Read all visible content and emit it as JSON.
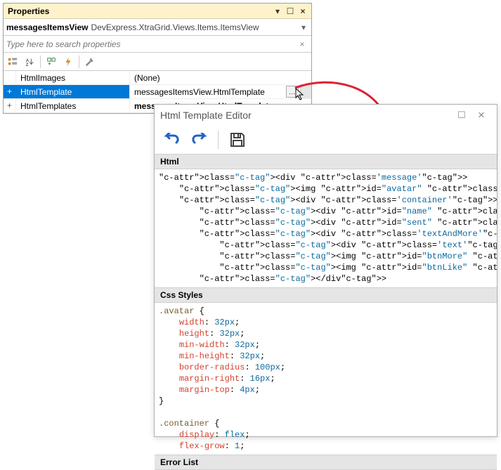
{
  "properties": {
    "title": "Properties",
    "object_name": "messagesItemsView",
    "object_type": "DevExpress.XtraGrid.Views.Items.ItemsView",
    "search_placeholder": "Type here to search properties",
    "rows": [
      {
        "exp": "",
        "name": "HtmlImages",
        "value": "(None)",
        "bold": false,
        "sel": false,
        "btn": false
      },
      {
        "exp": "+",
        "name": "HtmlTemplate",
        "value": "messagesItemsView.HtmlTemplate",
        "bold": false,
        "sel": true,
        "btn": true
      },
      {
        "exp": "+",
        "name": "HtmlTemplates",
        "value": "messagesItemsView.HtmlTemplates",
        "bold": true,
        "sel": false,
        "btn": false
      }
    ]
  },
  "editor": {
    "title": "Html Template Editor",
    "sections": {
      "html": "Html",
      "css": "Css Styles",
      "errors": "Error List"
    }
  },
  "chart_data": {
    "type": "code",
    "html_template": "<div class='message'>\n    <img id=\"avatar\" class=\"avatar\" src='${Owner.Avatar}' />\n    <div class='container'>\n        <div id=\"name\" class='name'>${Owner.UserName}</div>\n        <div id=\"sent\" class='sent'>${StatusText}</div>\n        <div class='textAndMore'>\n            <div class='text'>${Text}</div>\n            <img id=\"btnMore\" class='more' src='Menu' />\n            <img id=\"btnLike\" class='like' src='Like' hidden />\n        </div>",
    "css_styles": ".avatar {\n    width: 32px;\n    height: 32px;\n    min-width: 32px;\n    min-height: 32px;\n    border-radius: 100px;\n    margin-right: 16px;\n    margin-top: 4px;\n}\n\n.container {\n    display: flex;\n    flex-grow: 1;"
  }
}
